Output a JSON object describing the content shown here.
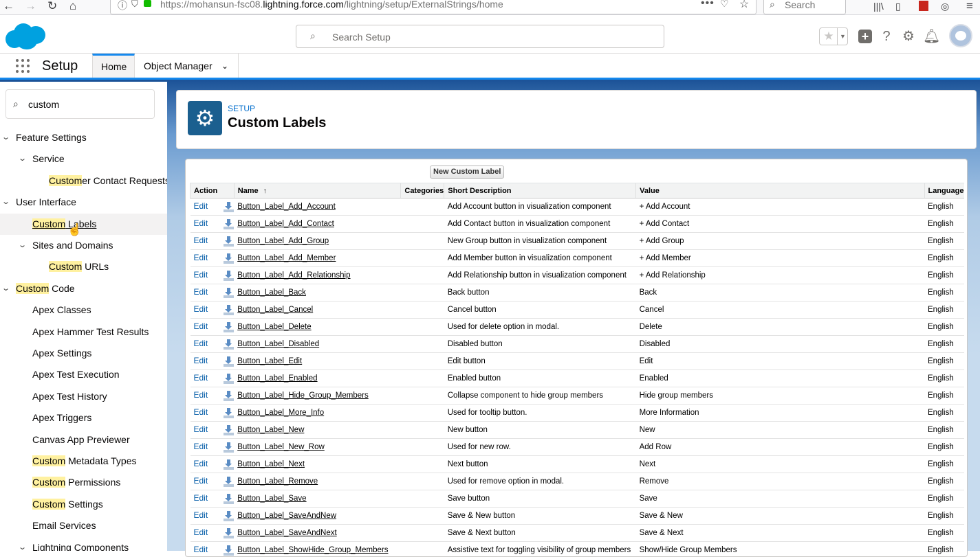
{
  "browser": {
    "url_prefix": "https://mohansun-fsc08.",
    "url_domain": "lightning.force.com",
    "url_path": "/lightning/setup/ExternalStrings/home",
    "search_placeholder": "Search"
  },
  "header": {
    "search_placeholder": "Search Setup"
  },
  "nav": {
    "app_title": "Setup",
    "tabs": [
      {
        "label": "Home",
        "active": true
      },
      {
        "label": "Object Manager",
        "active": false
      }
    ]
  },
  "sidebar": {
    "quick_find_value": "custom",
    "items": [
      {
        "hl": "",
        "rest": "Feature Settings",
        "level": 0,
        "chevron": true
      },
      {
        "hl": "",
        "rest": "Service",
        "level": 1,
        "chevron": true
      },
      {
        "hl": "Custom",
        "rest": "er Contact Requests",
        "level": 2,
        "chevron": false
      },
      {
        "hl": "",
        "rest": "User Interface",
        "level": 0,
        "chevron": true
      },
      {
        "hl": "Custom",
        "rest": " Labels",
        "level": 1,
        "chevron": false,
        "selected": true
      },
      {
        "hl": "",
        "rest": "Sites and Domains",
        "level": 1,
        "chevron": true
      },
      {
        "hl": "Custom",
        "rest": " URLs",
        "level": 2,
        "chevron": false
      },
      {
        "hl": "Custom",
        "rest": " Code",
        "level": 0,
        "chevron": true
      },
      {
        "hl": "",
        "rest": "Apex Classes",
        "level": 1,
        "chevron": false
      },
      {
        "hl": "",
        "rest": "Apex Hammer Test Results",
        "level": 1,
        "chevron": false
      },
      {
        "hl": "",
        "rest": "Apex Settings",
        "level": 1,
        "chevron": false
      },
      {
        "hl": "",
        "rest": "Apex Test Execution",
        "level": 1,
        "chevron": false
      },
      {
        "hl": "",
        "rest": "Apex Test History",
        "level": 1,
        "chevron": false
      },
      {
        "hl": "",
        "rest": "Apex Triggers",
        "level": 1,
        "chevron": false
      },
      {
        "hl": "",
        "rest": "Canvas App Previewer",
        "level": 1,
        "chevron": false
      },
      {
        "hl": "Custom",
        "rest": " Metadata Types",
        "level": 1,
        "chevron": false
      },
      {
        "hl": "Custom",
        "rest": " Permissions",
        "level": 1,
        "chevron": false
      },
      {
        "hl": "Custom",
        "rest": " Settings",
        "level": 1,
        "chevron": false
      },
      {
        "hl": "",
        "rest": "Email Services",
        "level": 1,
        "chevron": false
      },
      {
        "hl": "",
        "rest": "Lightning Components",
        "level": 1,
        "chevron": true
      }
    ]
  },
  "page": {
    "breadcrumb": "SETUP",
    "title": "Custom Labels",
    "new_button": "New Custom Label"
  },
  "table": {
    "columns": [
      "Action",
      "Name",
      "Categories",
      "Short Description",
      "Value",
      "Language"
    ],
    "sort_indicator": "↑",
    "edit_label": "Edit",
    "rows": [
      {
        "name": "Button_Label_Add_Account",
        "categories": "",
        "description": "Add Account button in visualization component",
        "value": "+ Add Account",
        "language": "English"
      },
      {
        "name": "Button_Label_Add_Contact",
        "categories": "",
        "description": "Add Contact button in visualization component",
        "value": "+ Add Contact",
        "language": "English"
      },
      {
        "name": "Button_Label_Add_Group",
        "categories": "",
        "description": "New Group button in visualization component",
        "value": "+ Add Group",
        "language": "English"
      },
      {
        "name": "Button_Label_Add_Member",
        "categories": "",
        "description": "Add Member button in visualization component",
        "value": "+ Add Member",
        "language": "English"
      },
      {
        "name": "Button_Label_Add_Relationship",
        "categories": "",
        "description": "Add Relationship button in visualization component",
        "value": "+ Add Relationship",
        "language": "English"
      },
      {
        "name": "Button_Label_Back",
        "categories": "",
        "description": "Back button",
        "value": "Back",
        "language": "English"
      },
      {
        "name": "Button_Label_Cancel",
        "categories": "",
        "description": "Cancel button",
        "value": "Cancel",
        "language": "English"
      },
      {
        "name": "Button_Label_Delete",
        "categories": "",
        "description": "Used for delete option in modal.",
        "value": "Delete",
        "language": "English"
      },
      {
        "name": "Button_Label_Disabled",
        "categories": "",
        "description": "Disabled button",
        "value": "Disabled",
        "language": "English"
      },
      {
        "name": "Button_Label_Edit",
        "categories": "",
        "description": "Edit button",
        "value": "Edit",
        "language": "English"
      },
      {
        "name": "Button_Label_Enabled",
        "categories": "",
        "description": "Enabled button",
        "value": "Enabled",
        "language": "English"
      },
      {
        "name": "Button_Label_Hide_Group_Members",
        "categories": "",
        "description": "Collapse component to hide group members",
        "value": "Hide group members",
        "language": "English"
      },
      {
        "name": "Button_Label_More_Info",
        "categories": "",
        "description": "Used for tooltip button.",
        "value": "More Information",
        "language": "English"
      },
      {
        "name": "Button_Label_New",
        "categories": "",
        "description": "New button",
        "value": "New",
        "language": "English"
      },
      {
        "name": "Button_Label_New_Row",
        "categories": "",
        "description": "Used for new row.",
        "value": "Add Row",
        "language": "English"
      },
      {
        "name": "Button_Label_Next",
        "categories": "",
        "description": "Next button",
        "value": "Next",
        "language": "English"
      },
      {
        "name": "Button_Label_Remove",
        "categories": "",
        "description": "Used for remove option in modal.",
        "value": "Remove",
        "language": "English"
      },
      {
        "name": "Button_Label_Save",
        "categories": "",
        "description": "Save button",
        "value": "Save",
        "language": "English"
      },
      {
        "name": "Button_Label_SaveAndNew",
        "categories": "",
        "description": "Save & New button",
        "value": "Save & New",
        "language": "English"
      },
      {
        "name": "Button_Label_SaveAndNext",
        "categories": "",
        "description": "Save & Next button",
        "value": "Save & Next",
        "language": "English"
      },
      {
        "name": "Button_Label_ShowHide_Group_Members",
        "categories": "",
        "description": "Assistive text for toggling visibility of group members",
        "value": "Show/Hide Group Members",
        "language": "English"
      }
    ]
  },
  "colors": {
    "brand_blue": "#1589ee",
    "link_blue": "#015ba7",
    "highlight": "#fff1a0",
    "salesforce_cloud": "#00a1e0"
  }
}
